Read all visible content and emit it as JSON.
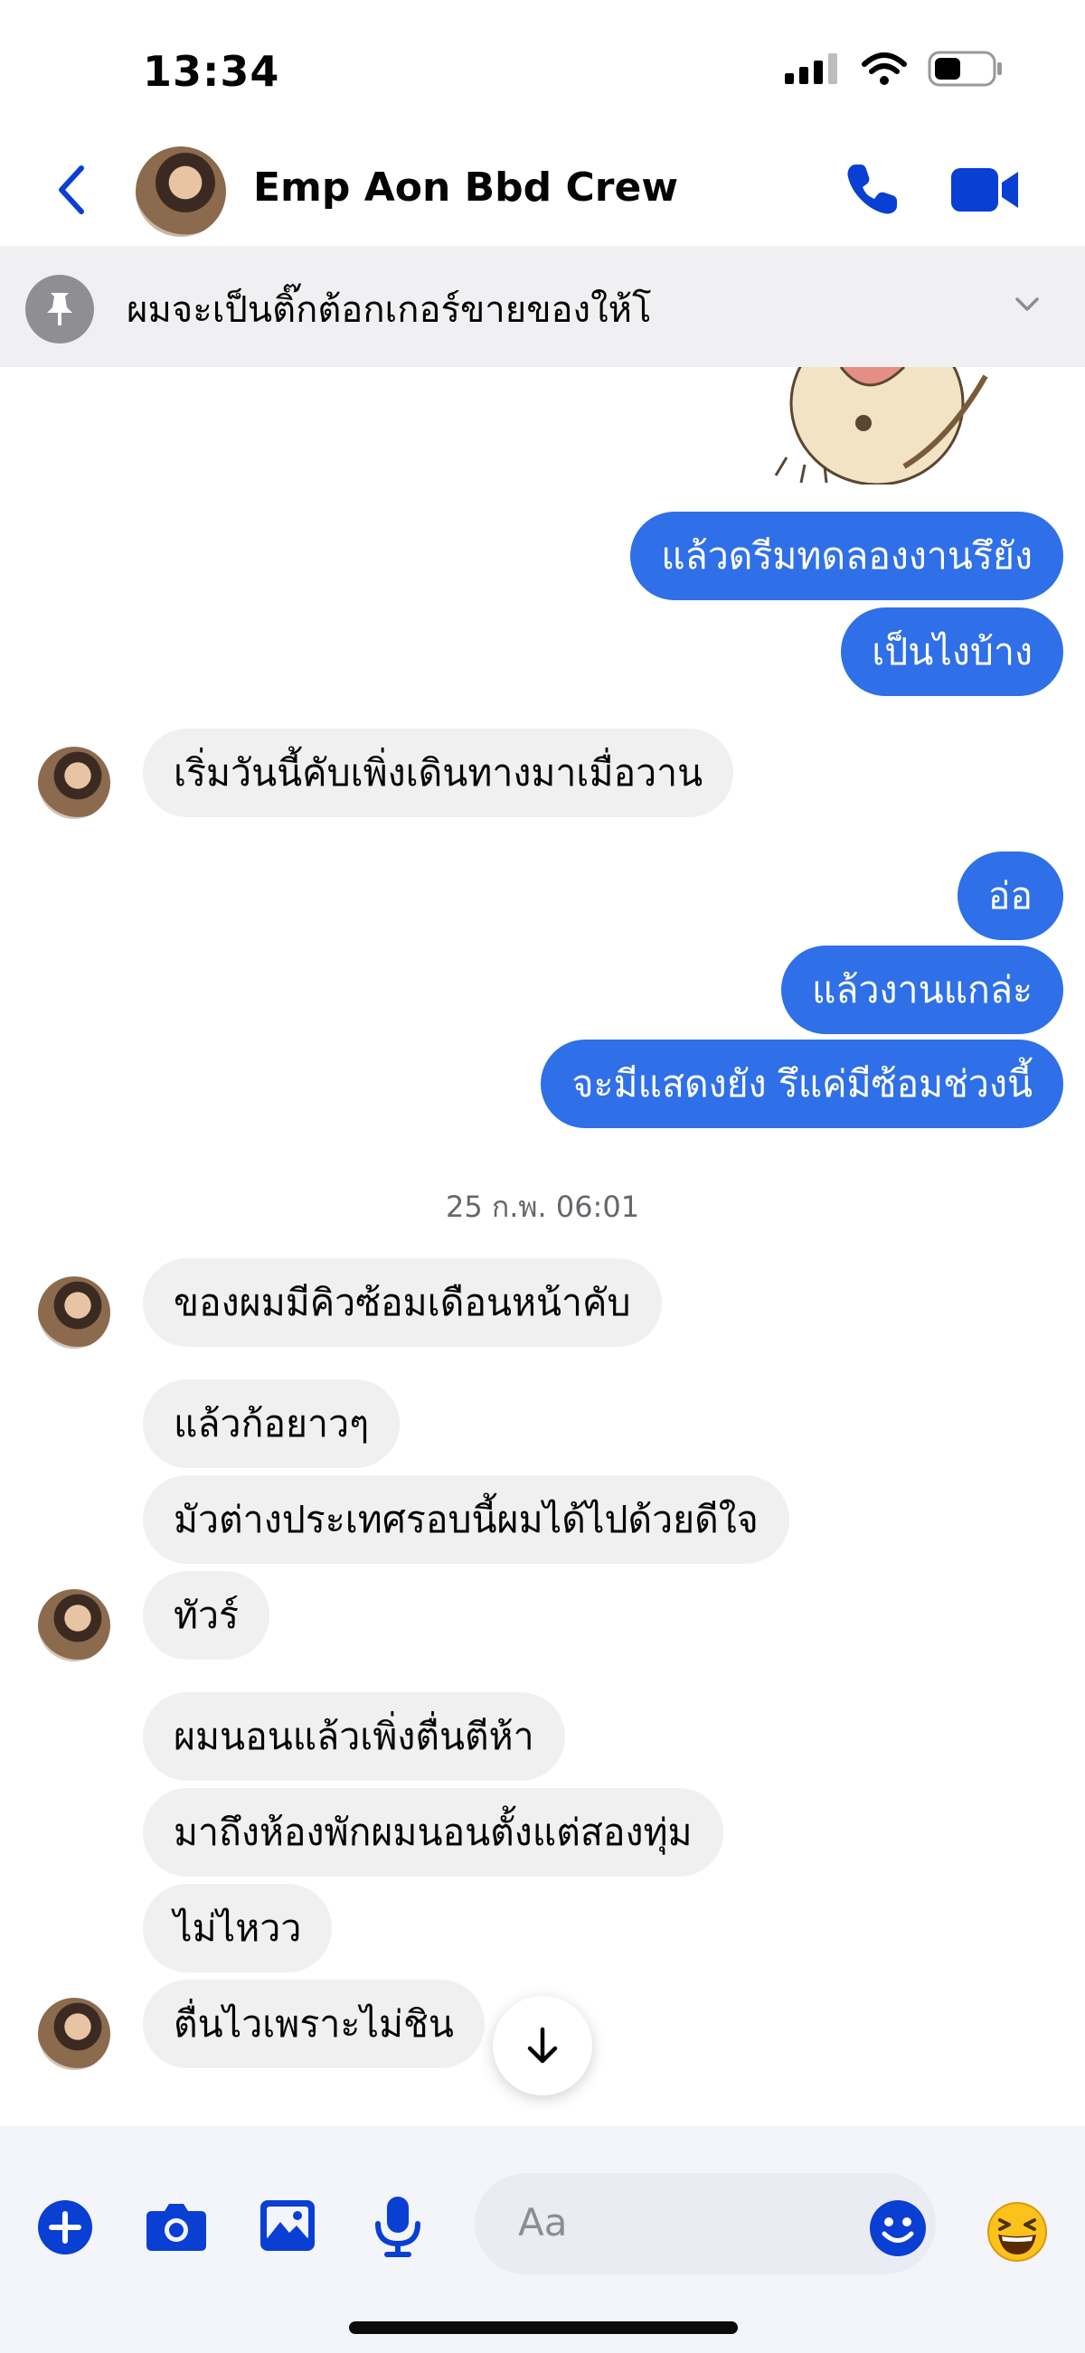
{
  "status_bar": {
    "time": "13:34"
  },
  "header": {
    "contact_name": "Emp Aon Bbd Crew"
  },
  "pinned": {
    "text": "ผมจะเป็นติ๊กต้อกเกอร์ขายของให้โ"
  },
  "messages_out_1": [
    "แล้วดรีมทดลองงานรึยัง",
    "เป็นไงบ้าง"
  ],
  "messages_in_1": [
    "เริ่มวันนี้คับเพิ่งเดินทางมาเมื่อวาน"
  ],
  "messages_out_2": [
    "อ่อ",
    "แล้วงานแกล่ะ",
    "จะมีแสดงยัง รึแค่มีซ้อมช่วงนี้"
  ],
  "timestamp": "25 ก.พ. 06:01",
  "messages_in_2": [
    "ของผมมีคิวซ้อมเดือนหน้าคับ",
    "แล้วก้อยาวๆ",
    "มัวต่างประเทศรอบนี้ผมได้ไปด้วยดีใจ",
    "ทัวร์",
    "ผมนอนแล้วเพิ่งตื่นตีห้า",
    "มาถึงห้องพักผมนอนตั้งแต่สองทุ่ม",
    "ไม่ไหวว",
    "ตื่นไวเพราะไม่ชิน"
  ],
  "composer": {
    "placeholder": "Aa"
  },
  "colors": {
    "accent": "#2f6fe8",
    "icon_blue": "#0a3fd4",
    "incoming_bubble": "#f0f0f0"
  },
  "icons": [
    "back-icon",
    "phone-icon",
    "video-icon",
    "pin-icon",
    "chevron-down-icon",
    "arrow-down-icon",
    "plus-icon",
    "camera-icon",
    "image-icon",
    "microphone-icon",
    "emoji-icon",
    "laughing-emoji-icon"
  ]
}
